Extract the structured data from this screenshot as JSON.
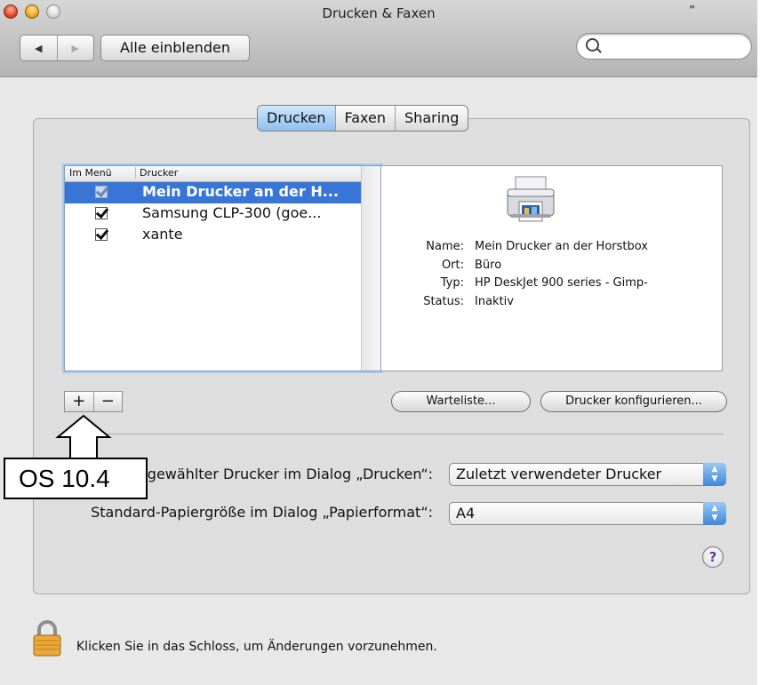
{
  "window": {
    "title": "Drucken & Faxen",
    "title_mark": "„"
  },
  "toolbar": {
    "back": "◀",
    "forward": "▶",
    "show_all_label": "Alle einblenden",
    "search_placeholder": ""
  },
  "tabs": [
    {
      "label": "Drucken",
      "active": true
    },
    {
      "label": "Faxen",
      "active": false
    },
    {
      "label": "Sharing",
      "active": false
    }
  ],
  "printer_list": {
    "headers": {
      "in_menu": "Im Menü",
      "printer": "Drucker"
    },
    "rows": [
      {
        "name": "Mein Drucker an der H...",
        "checked": true,
        "selected": true
      },
      {
        "name": "Samsung CLP-300 (goe...",
        "checked": true,
        "selected": false
      },
      {
        "name": "xante",
        "checked": true,
        "selected": false
      }
    ]
  },
  "details": {
    "name_label": "Name:",
    "name_value": "Mein Drucker an der Horstbox",
    "location_label": "Ort:",
    "location_value": "Büro",
    "type_label": "Typ:",
    "type_value": "HP DeskJet 900 series - Gimp-",
    "status_label": "Status:",
    "status_value": "Inaktiv"
  },
  "buttons": {
    "add": "+",
    "remove": "−",
    "queue": "Warteliste...",
    "configure": "Drucker konfigurieren..."
  },
  "settings": {
    "default_printer_label": "Ausgewählter Drucker im Dialog „Drucken“:",
    "default_printer_label_visible": "hlter Drucker im Dialog „Drucken“:",
    "default_printer_value": "Zuletzt verwendeter Drucker",
    "paper_size_label": "Standard-Papiergröße im Dialog „Papierformat“:",
    "paper_size_value": "A4"
  },
  "help_label": "?",
  "lock_text": "Klicken Sie in das Schloss, um Änderungen vorzunehmen.",
  "annotation": {
    "label": "OS 10.4"
  },
  "colors": {
    "selection": "#3875d7",
    "tab_active": "#8fc0ee",
    "popup_arrows": "#3d87d9"
  }
}
